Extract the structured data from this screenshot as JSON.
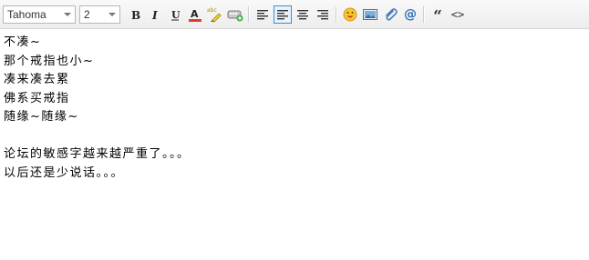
{
  "toolbar": {
    "font_family": "Tahoma",
    "font_size": "2",
    "buttons": [
      {
        "name": "bold-button",
        "icon": "bold-icon"
      },
      {
        "name": "italic-button",
        "icon": "italic-icon"
      },
      {
        "name": "underline-button",
        "icon": "underline-icon"
      },
      {
        "name": "font-color-button",
        "icon": "font-color-icon"
      },
      {
        "name": "highlight-button",
        "icon": "highlighter-icon"
      },
      {
        "name": "insert-link-button",
        "icon": "link-icon"
      },
      {
        "name": "align-left-button",
        "icon": "align-left-icon"
      },
      {
        "name": "align-center-button",
        "icon": "align-center-icon",
        "active": true
      },
      {
        "name": "align-justify-button",
        "icon": "align-justify-icon"
      },
      {
        "name": "align-right-button",
        "icon": "align-right-icon"
      },
      {
        "name": "emoji-button",
        "icon": "smiley-icon"
      },
      {
        "name": "insert-image-button",
        "icon": "image-icon"
      },
      {
        "name": "attachment-button",
        "icon": "paperclip-icon"
      },
      {
        "name": "mention-button",
        "icon": "at-icon"
      },
      {
        "name": "quote-button",
        "icon": "quote-icon"
      },
      {
        "name": "code-button",
        "icon": "code-icon"
      }
    ],
    "highlight_label": "abc",
    "mention_label": "@",
    "quote_label": "“",
    "code_label": "<>",
    "colors": {
      "accent": "#3f8ccf",
      "font_color_bar": "#e23b2a",
      "highlight_bar": "#f2d21b"
    }
  },
  "content": {
    "lines": [
      "不凑~",
      "那个戒指也小~",
      "凑来凑去累",
      "佛系买戒指",
      "随缘~随缘~",
      "",
      "论坛的敏感字越来越严重了。。。",
      "以后还是少说话。。。"
    ]
  }
}
